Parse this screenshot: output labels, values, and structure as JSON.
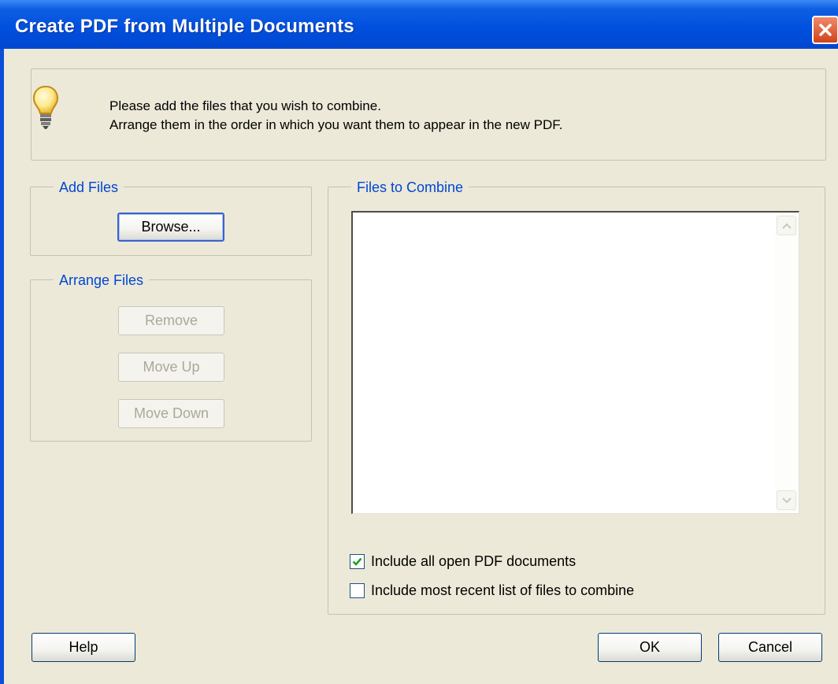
{
  "window": {
    "title": "Create PDF from Multiple Documents"
  },
  "info": {
    "line1": "Please add the files that you wish to combine.",
    "line2": "Arrange them in the order in which you want them to appear in the new PDF."
  },
  "add_files": {
    "legend": "Add Files",
    "browse_label": "Browse..."
  },
  "arrange_files": {
    "legend": "Arrange Files",
    "remove_label": "Remove",
    "move_up_label": "Move Up",
    "move_down_label": "Move Down"
  },
  "files_to_combine": {
    "legend": "Files to Combine",
    "items": [],
    "include_open_label": "Include all open PDF documents",
    "include_open_checked": true,
    "include_recent_label": "Include most recent list of files to combine",
    "include_recent_checked": false
  },
  "footer": {
    "help_label": "Help",
    "ok_label": "OK",
    "cancel_label": "Cancel"
  },
  "colors": {
    "titlebar": "#0050df",
    "dialog_bg": "#ece9d8",
    "legend_text": "#0046d5",
    "checkmark": "#21a121"
  },
  "icons": {
    "info": "lightbulb-icon",
    "close": "close-icon",
    "scroll_up": "scroll-up-arrow-icon",
    "scroll_down": "scroll-down-arrow-icon"
  }
}
